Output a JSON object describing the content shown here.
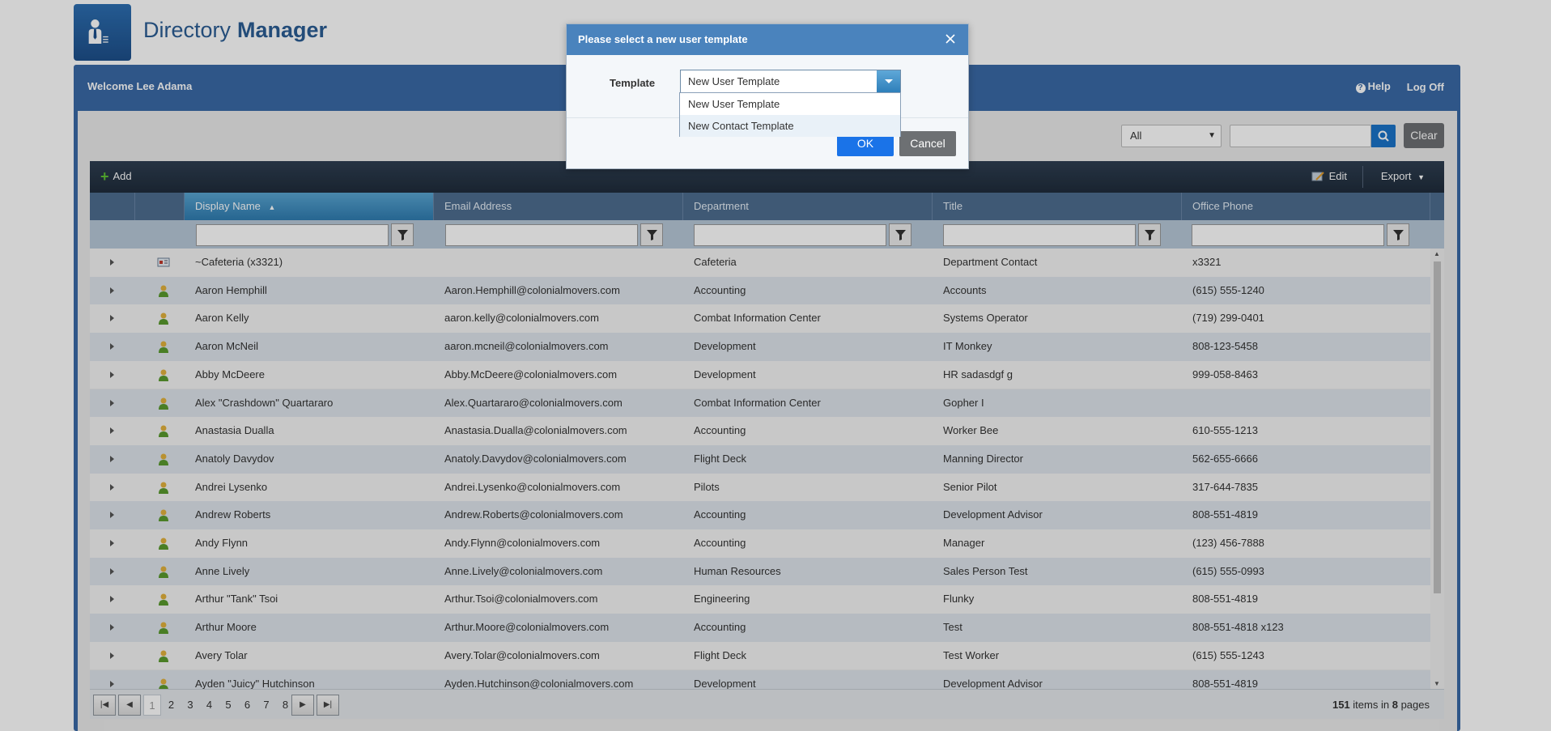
{
  "header": {
    "app_name_part1": "Directory",
    "app_name_part2": "Manager",
    "welcome": "Welcome Lee Adama",
    "help": "Help",
    "logoff": "Log Off"
  },
  "search": {
    "scope": "All",
    "query": "",
    "clear": "Clear"
  },
  "toolbar": {
    "add": "Add",
    "edit": "Edit",
    "export": "Export"
  },
  "grid": {
    "columns": [
      "Display Name",
      "Email Address",
      "Department",
      "Title",
      "Office Phone"
    ],
    "sorted_column": "Display Name",
    "rows": [
      {
        "type": "contact",
        "name": "~Cafeteria (x3321)",
        "email": "",
        "dept": "Cafeteria",
        "title": "Department Contact",
        "phone": "x3321"
      },
      {
        "type": "user",
        "name": "Aaron Hemphill",
        "email": "Aaron.Hemphill@colonialmovers.com",
        "dept": "Accounting",
        "title": "Accounts",
        "phone": "(615) 555-1240"
      },
      {
        "type": "user",
        "name": "Aaron Kelly",
        "email": "aaron.kelly@colonialmovers.com",
        "dept": "Combat Information Center",
        "title": "Systems Operator",
        "phone": "(719) 299-0401"
      },
      {
        "type": "user",
        "name": "Aaron McNeil",
        "email": "aaron.mcneil@colonialmovers.com",
        "dept": "Development",
        "title": "IT Monkey",
        "phone": "808-123-5458"
      },
      {
        "type": "user",
        "name": "Abby McDeere",
        "email": "Abby.McDeere@colonialmovers.com",
        "dept": "Development",
        "title": "HR sadasdgf g",
        "phone": "999-058-8463"
      },
      {
        "type": "user",
        "name": "Alex \"Crashdown\" Quartararo",
        "email": "Alex.Quartararo@colonialmovers.com",
        "dept": "Combat Information Center",
        "title": "Gopher I",
        "phone": ""
      },
      {
        "type": "user",
        "name": "Anastasia Dualla",
        "email": "Anastasia.Dualla@colonialmovers.com",
        "dept": "Accounting",
        "title": "Worker Bee",
        "phone": "610-555-1213"
      },
      {
        "type": "user",
        "name": "Anatoly Davydov",
        "email": "Anatoly.Davydov@colonialmovers.com",
        "dept": "Flight Deck",
        "title": "Manning Director",
        "phone": "562-655-6666"
      },
      {
        "type": "user",
        "name": "Andrei Lysenko",
        "email": "Andrei.Lysenko@colonialmovers.com",
        "dept": "Pilots",
        "title": "Senior Pilot",
        "phone": "317-644-7835"
      },
      {
        "type": "user",
        "name": "Andrew Roberts",
        "email": "Andrew.Roberts@colonialmovers.com",
        "dept": "Accounting",
        "title": "Development Advisor",
        "phone": "808-551-4819"
      },
      {
        "type": "user",
        "name": "Andy Flynn",
        "email": "Andy.Flynn@colonialmovers.com",
        "dept": "Accounting",
        "title": "Manager",
        "phone": "(123) 456-7888"
      },
      {
        "type": "user",
        "name": "Anne Lively",
        "email": "Anne.Lively@colonialmovers.com",
        "dept": "Human Resources",
        "title": "Sales Person Test",
        "phone": "(615) 555-0993"
      },
      {
        "type": "user",
        "name": "Arthur \"Tank\" Tsoi",
        "email": "Arthur.Tsoi@colonialmovers.com",
        "dept": "Engineering",
        "title": "Flunky",
        "phone": "808-551-4819"
      },
      {
        "type": "user",
        "name": "Arthur Moore",
        "email": "Arthur.Moore@colonialmovers.com",
        "dept": "Accounting",
        "title": "Test",
        "phone": "808-551-4818 x123"
      },
      {
        "type": "user",
        "name": "Avery Tolar",
        "email": "Avery.Tolar@colonialmovers.com",
        "dept": "Flight Deck",
        "title": "Test Worker",
        "phone": "(615) 555-1243"
      },
      {
        "type": "user",
        "name": "Ayden \"Juicy\" Hutchinson",
        "email": "Ayden.Hutchinson@colonialmovers.com",
        "dept": "Development",
        "title": "Development Advisor",
        "phone": "808-551-4819"
      }
    ]
  },
  "pager": {
    "pages": [
      "1",
      "2",
      "3",
      "4",
      "5",
      "6",
      "7",
      "8"
    ],
    "current_page": "1",
    "total_items": "151",
    "items_in": "items in",
    "total_pages": "8",
    "pages_label": "pages"
  },
  "dialog": {
    "title": "Please select a new user template",
    "template_label": "Template",
    "selected": "New User Template",
    "options": [
      "New User Template",
      "New Contact Template"
    ],
    "hovered_option": "New Contact Template",
    "ok": "OK",
    "cancel": "Cancel"
  },
  "colors": {
    "brand_blue": "#3a6aa6",
    "dialog_header": "#4a83bd",
    "ok_button": "#1a73e8",
    "neutral_button": "#6d7073"
  }
}
